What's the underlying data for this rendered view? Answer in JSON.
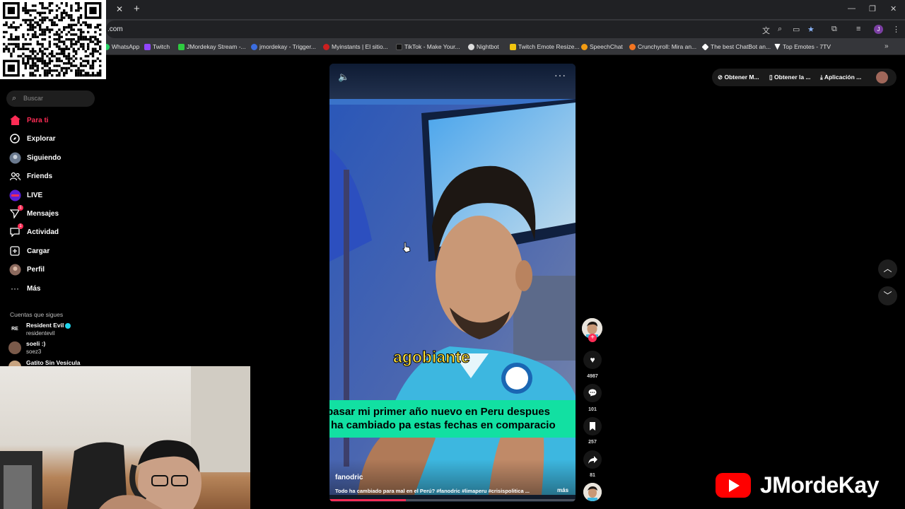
{
  "browser": {
    "url_fragment": ".com",
    "bookmarks": [
      {
        "label": "WhatsApp",
        "color": "#25d366"
      },
      {
        "label": "Twitch",
        "color": "#9146ff"
      },
      {
        "label": "JMordekay Stream -...",
        "color": "#2ecc40"
      },
      {
        "label": "jmordekay - Trigger...",
        "color": "#3b6de0"
      },
      {
        "label": "Myinstants | El sitio...",
        "color": "#cc1f1f"
      },
      {
        "label": "TikTok - Make Your...",
        "color": "#111111"
      },
      {
        "label": "Nightbot",
        "color": "#dddddd"
      },
      {
        "label": "Twitch Emote Resize...",
        "color": "#f1c40f"
      },
      {
        "label": "SpeechChat",
        "color": "#f39c12"
      },
      {
        "label": "Crunchyroll: Mira an...",
        "color": "#f47521"
      },
      {
        "label": "The best ChatBot an...",
        "color": "#ffffff"
      },
      {
        "label": "Top Emotes - 7TV",
        "color": "#ffffff"
      }
    ],
    "profile_initial": "J"
  },
  "sidebar": {
    "search_placeholder": "Buscar",
    "nav": [
      {
        "label": "Para ti",
        "icon": "home-icon",
        "active": true
      },
      {
        "label": "Explorar",
        "icon": "compass-icon"
      },
      {
        "label": "Siguiendo",
        "icon": "following-avatar-icon"
      },
      {
        "label": "Friends",
        "icon": "friends-icon"
      },
      {
        "label": "LIVE",
        "icon": "live-icon"
      },
      {
        "label": "Mensajes",
        "icon": "send-icon",
        "badge": "1"
      },
      {
        "label": "Actividad",
        "icon": "activity-icon",
        "badge": "1"
      },
      {
        "label": "Cargar",
        "icon": "upload-icon"
      },
      {
        "label": "Perfil",
        "icon": "profile-avatar-icon"
      },
      {
        "label": "Más",
        "icon": "more-dots-icon"
      }
    ],
    "following_header": "Cuentas que sigues",
    "accounts": [
      {
        "name": "Resident Evil",
        "handle": "residentevil",
        "verified": true,
        "avatar_text": "RE"
      },
      {
        "name": "soeli :)",
        "handle": "soez3",
        "verified": false
      },
      {
        "name": "Gatito Sin Vesícula",
        "handle": "",
        "verified": false
      }
    ]
  },
  "video": {
    "keyword": "agobiante",
    "subtitle_line1": "pasar mi primer año nuevo en Peru despues",
    "subtitle_line2": "ha cambiado pa estas fechas en comparacio",
    "author": "fanodric",
    "caption": "Todo ha cambiado para mal en el Perú? #fanodric #limaperu #crisispolitica ...",
    "more_label": "más",
    "progress": 0.31
  },
  "actions": {
    "likes": "4987",
    "comments": "101",
    "saves": "257",
    "shares": "81"
  },
  "topbar": {
    "item1": "Obtener M...",
    "item2": "Obtener la ...",
    "item3": "Aplicación ..."
  },
  "watermark": {
    "brand": "JMordeKay"
  },
  "colors": {
    "accent": "#fe2c55",
    "subtitle_bg": "#12e0a2",
    "keyword": "#ffe13c",
    "youtube": "#ff0000"
  }
}
